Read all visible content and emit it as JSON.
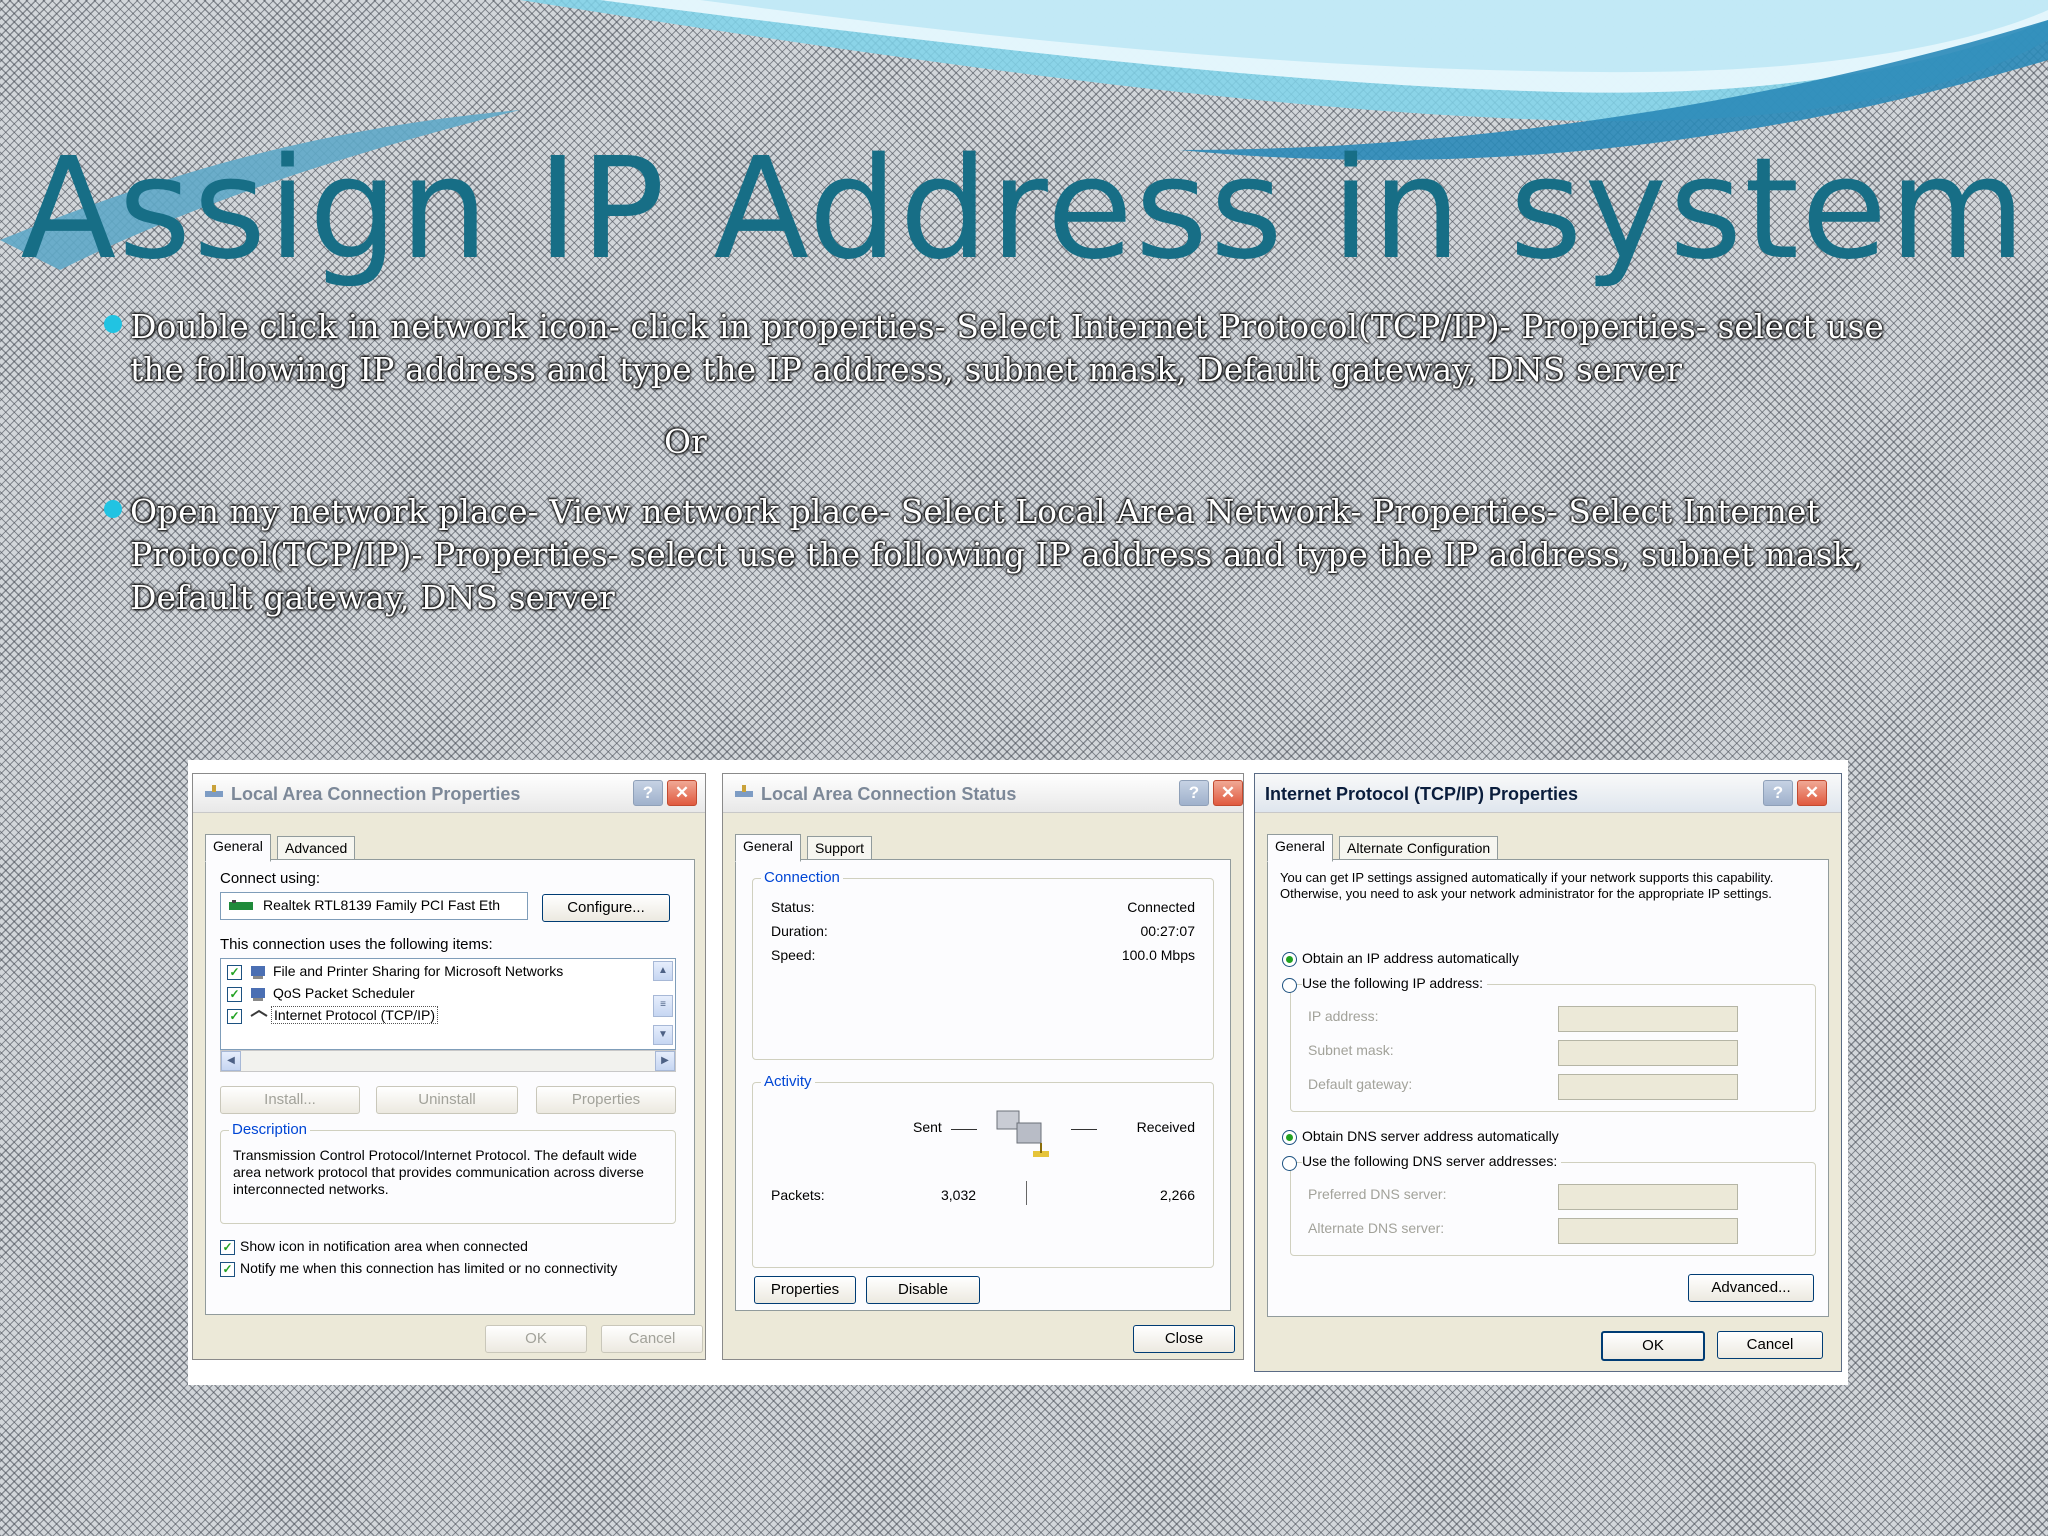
{
  "slide": {
    "title": "Assign IP Address in system",
    "bullet1": "Double click in network icon- click in properties- Select Internet Protocol(TCP/IP)- Properties- select use the following IP address and type the IP address, subnet mask, Default gateway, DNS server",
    "or": "Or",
    "bullet2": "Open my network place- View network place- Select Local Area Network- Properties- Select Internet Protocol(TCP/IP)- Properties- select use the following IP address and type the IP address, subnet mask, Default gateway, DNS server"
  },
  "colors": {
    "title": "#176e86",
    "bullet": "#21c3e2",
    "link_blue": "#0046d5"
  },
  "lac_properties": {
    "title": "Local Area Connection Properties",
    "tabs": [
      "General",
      "Advanced"
    ],
    "connect_using": "Connect using:",
    "adapter": "Realtek RTL8139 Family PCI Fast Eth",
    "configure": "Configure...",
    "items_heading": "This connection uses the following items:",
    "items": [
      "File and Printer Sharing for Microsoft Networks",
      "QoS Packet Scheduler",
      "Internet Protocol (TCP/IP)"
    ],
    "install": "Install...",
    "uninstall": "Uninstall",
    "properties": "Properties",
    "description_title": "Description",
    "description": "Transmission Control Protocol/Internet Protocol. The default wide area network protocol that provides communication across diverse interconnected networks.",
    "show_icon": "Show icon in notification area when connected",
    "notify": "Notify me when this connection has limited or no connectivity",
    "ok": "OK",
    "cancel": "Cancel"
  },
  "lac_status": {
    "title": "Local Area Connection Status",
    "tabs": [
      "General",
      "Support"
    ],
    "connection_title": "Connection",
    "status_label": "Status:",
    "status_value": "Connected",
    "duration_label": "Duration:",
    "duration_value": "00:27:07",
    "speed_label": "Speed:",
    "speed_value": "100.0 Mbps",
    "activity_title": "Activity",
    "sent": "Sent",
    "received": "Received",
    "packets_label": "Packets:",
    "packets_sent": "3,032",
    "packets_received": "2,266",
    "properties": "Properties",
    "disable": "Disable",
    "close": "Close"
  },
  "tcpip": {
    "title": "Internet Protocol (TCP/IP) Properties",
    "tabs": [
      "General",
      "Alternate Configuration"
    ],
    "intro": "You can get IP settings assigned automatically if your network supports this capability. Otherwise, you need to ask your network administrator for the appropriate IP settings.",
    "obtain_ip": "Obtain an IP address automatically",
    "use_ip": "Use the following IP address:",
    "ip_address": "IP address:",
    "subnet_mask": "Subnet mask:",
    "default_gateway": "Default gateway:",
    "obtain_dns": "Obtain DNS server address automatically",
    "use_dns": "Use the following DNS server addresses:",
    "preferred_dns": "Preferred DNS server:",
    "alternate_dns": "Alternate DNS server:",
    "advanced": "Advanced...",
    "ok": "OK",
    "cancel": "Cancel"
  }
}
